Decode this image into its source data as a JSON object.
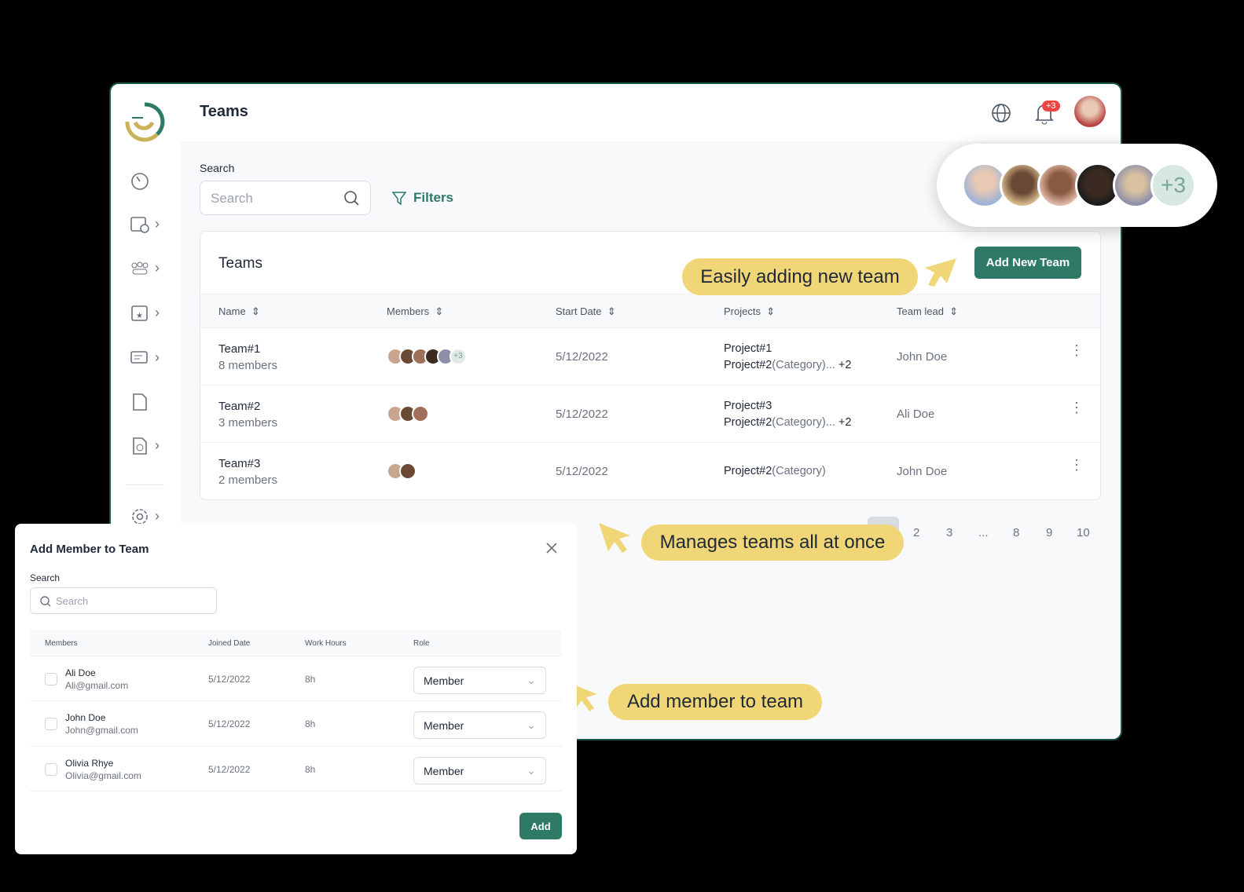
{
  "header": {
    "title": "Teams",
    "notification_badge": "+3"
  },
  "search": {
    "label": "Search",
    "placeholder": "Search"
  },
  "filters_label": "Filters",
  "teams_card": {
    "title": "Teams",
    "add_button": "Add New Team",
    "columns": [
      "Name",
      "Members",
      "Start Date",
      "Projects",
      "Team lead"
    ],
    "rows": [
      {
        "name": "Team#1",
        "members": "8 members",
        "extra_avatars": "+3",
        "start": "5/12/2022",
        "project1": "Project#1",
        "project2": "Project#2",
        "project2_cat": "(Category)...",
        "project_more": "+2",
        "lead": "John Doe"
      },
      {
        "name": "Team#2",
        "members": "3 members",
        "start": "5/12/2022",
        "project1": "Project#3",
        "project2": "Project#2",
        "project2_cat": "(Category)...",
        "project_more": "+2",
        "lead": "Ali Doe"
      },
      {
        "name": "Team#3",
        "members": "2 members",
        "start": "5/12/2022",
        "project1": "",
        "project2": "Project#2",
        "project2_cat": "(Category)",
        "project_more": "",
        "lead": "John Doe"
      }
    ]
  },
  "pagination": [
    "2",
    "3",
    "...",
    "8",
    "9",
    "10"
  ],
  "avatar_popover": {
    "extra": "+3"
  },
  "callouts": {
    "add_team": "Easily adding new team",
    "manage": "Manages teams all at once",
    "add_member": "Add member to team"
  },
  "modal": {
    "title": "Add Member to Team",
    "search_label": "Search",
    "search_placeholder": "Search",
    "columns": [
      "Members",
      "Joined Date",
      "Work Hours",
      "Role"
    ],
    "rows": [
      {
        "name": "Ali Doe",
        "email": "Ali@gmail.com",
        "joined": "5/12/2022",
        "hours": "8h",
        "role": "Member"
      },
      {
        "name": "John Doe",
        "email": "John@gmail.com",
        "joined": "5/12/2022",
        "hours": "8h",
        "role": "Member"
      },
      {
        "name": "Olivia Rhye",
        "email": "Olivia@gmail.com",
        "joined": "5/12/2022",
        "hours": "8h",
        "role": "Member"
      }
    ],
    "add_button": "Add"
  },
  "colors": {
    "brand": "#2f7a67",
    "callout": "#f0d676",
    "badge": "#ef4444"
  }
}
